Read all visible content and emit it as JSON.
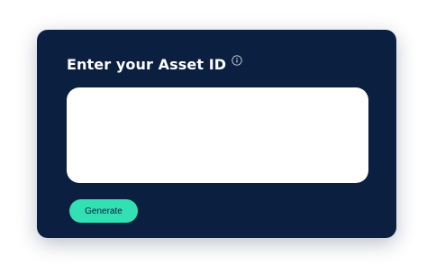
{
  "card": {
    "heading": "Enter your Asset ID",
    "info_icon": "info-icon",
    "input": {
      "value": "",
      "placeholder": ""
    },
    "generate_label": "Generate"
  },
  "colors": {
    "card_background": "#0b2040",
    "accent": "#33e0b3",
    "heading_text": "#ffffff"
  }
}
